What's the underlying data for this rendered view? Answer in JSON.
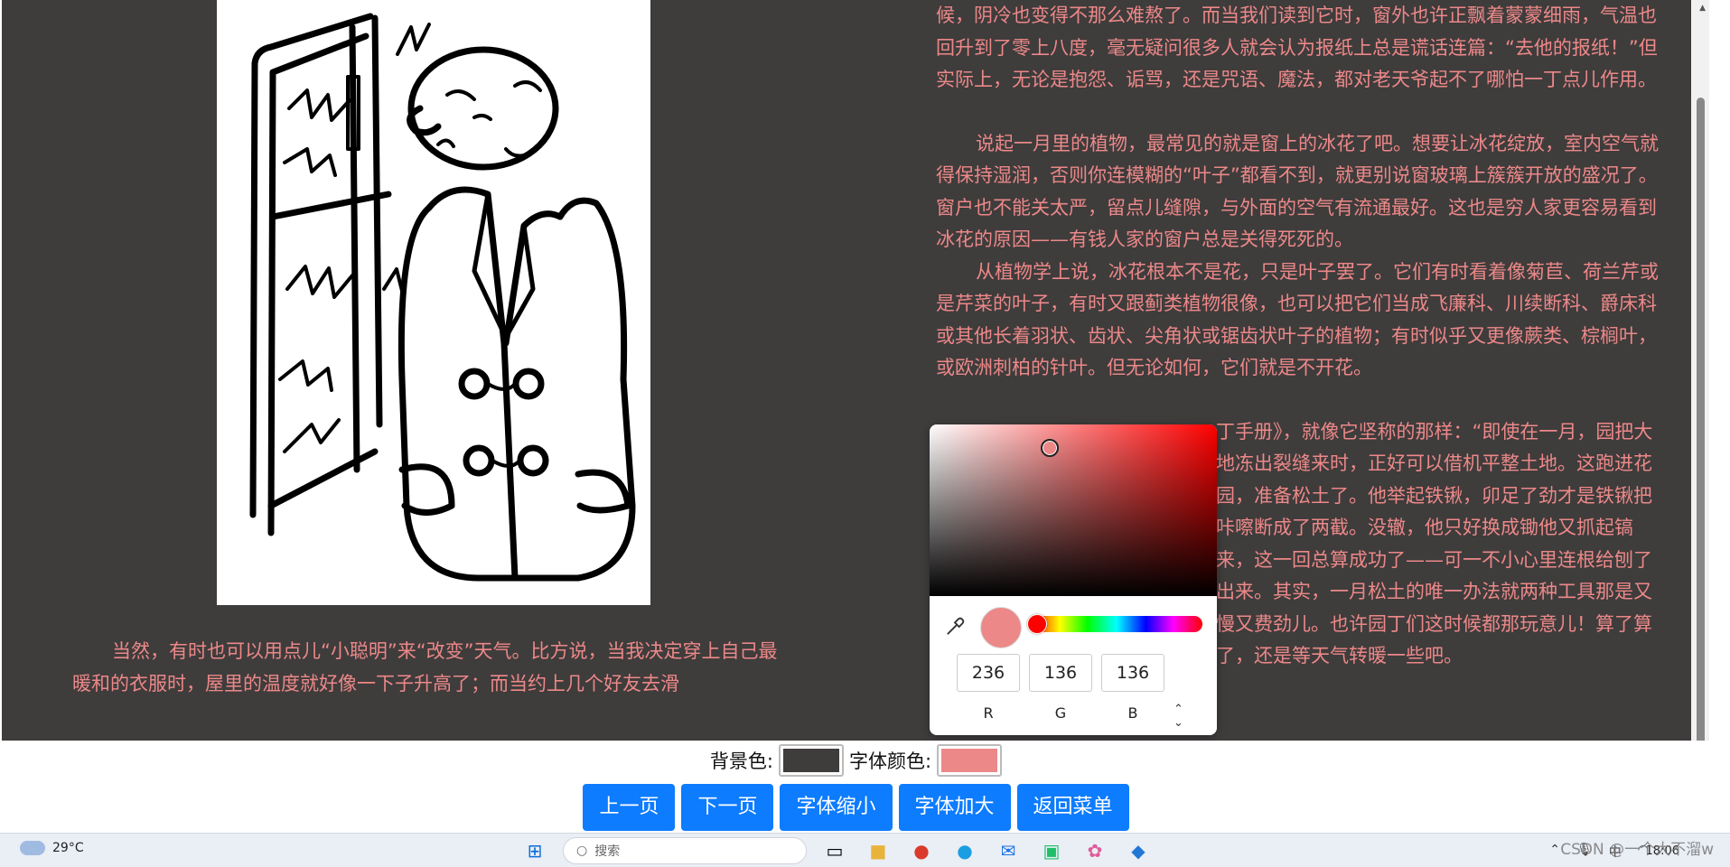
{
  "colors": {
    "page_background": "#3f3c3c",
    "text_color": "#ec8888",
    "button": "#0d7cff",
    "picker_preview": "#ec8888"
  },
  "reader": {
    "right_paragraphs": [
      {
        "text": "候，阴冷也变得不那么难熬了。而当我们读到它时，窗外也许正飘着蒙蒙细雨，气温也回升到了零上八度，毫无疑问很多人就会认为报纸上总是谎话连篇：“去他的报纸！”但实际上，无论是抱怨、诟骂，还是咒语、魔法，都对老天爷起不了哪怕一丁点儿作用。",
        "indent": false
      },
      {
        "text": "说起一月里的植物，最常见的就是窗上的冰花了吧。想要让冰花绽放，室内空气就得保持湿润，否则你连模糊的“叶子”都看不到，就更别说窗玻璃上簇簇开放的盛况了。窗户也不能关太严，留点儿缝隙，与外面的空气有流通最好。这也是穷人家更容易看到冰花的原因——有钱人家的窗户总是关得死死的。",
        "indent": true
      },
      {
        "text": "从植物学上说，冰花根本不是花，只是叶子罢了。它们有时看着像菊苣、荷兰芹或是芹菜的叶子，有时又跟蓟类植物很像，也可以把它们当成飞廉科、川续断科、爵床科或其他长着羽状、齿状、尖角状或锯齿状叶子的植物；有时似乎又更像蕨类、棕榈叶，或欧洲刺柏的针叶。但无论如何，它们就是不开花。",
        "indent": true
      },
      {
        "text": "丁手册》，就像它坚称的那样：“即使在一月，园把大地冻出裂缝来时，正好可以借机平整土地。这跑进花园，准备松土了。他举起铁锹，卯足了劲才是铁锹把咔嚓断成了两截。没辙，他只好换成锄他又抓起镐来，这一回总算成功了——可一不小心里连根给刨了出来。其实，一月松土的唯一办法就两种工具那是又慢又费劲儿。也许园丁们这时候都那玩意儿！算了算了，还是等天气转暖一些吧。",
        "indent": false
      }
    ],
    "left_paragraph": "当然，有时也可以用点儿“小聪明”来“改变”天气。比方说，当我决定穿上自己最暖和的衣服时，屋里的温度就好像一下子升高了；而当约上几个好友去滑"
  },
  "color_picker": {
    "r": "236",
    "g": "136",
    "b": "136",
    "label_r": "R",
    "label_g": "G",
    "label_b": "B",
    "hue_degrees": 0,
    "eyedropper_icon": "eyedropper-icon",
    "mode_icon": "chevron-up-down-icon"
  },
  "controls": {
    "bg_label": "背景色:",
    "bg_value": "#3f3c3c",
    "font_label": "字体颜色:",
    "font_value": "#ec8888",
    "buttons": [
      "上一页",
      "下一页",
      "字体缩小",
      "字体加大",
      "返回菜单"
    ]
  },
  "taskbar": {
    "weather": "29°C",
    "search_placeholder": "搜索",
    "time": "18:06",
    "apps": [
      "windows-start-icon",
      "task-view-icon",
      "file-explorer-icon",
      "chrome-icon",
      "edge-icon",
      "mail-icon",
      "pycharm-icon",
      "paint-icon",
      "vscode-icon"
    ]
  },
  "watermark": "CSDN @一个大不溜w"
}
